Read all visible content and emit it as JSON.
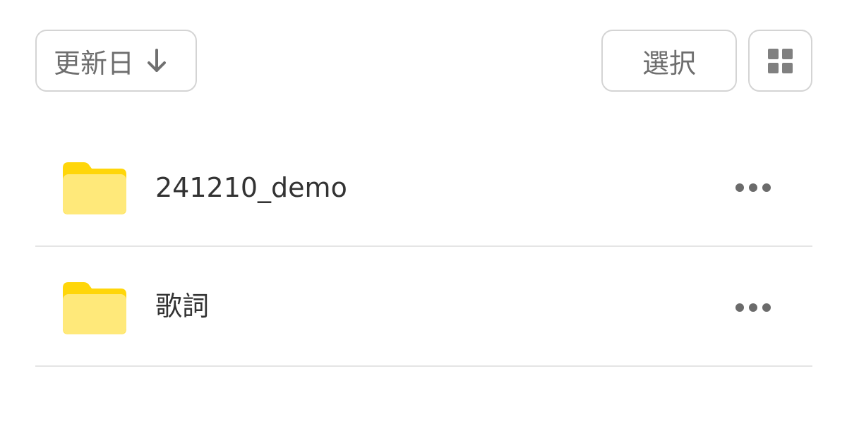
{
  "toolbar": {
    "sort_label": "更新日",
    "sort_direction": "descending",
    "sort_icon": "arrow-down-icon",
    "select_label": "選択",
    "view_icon": "grid-view-icon"
  },
  "folders": [
    {
      "name": "241210_demo",
      "icon": "folder-icon",
      "more_icon": "more-horizontal-icon"
    },
    {
      "name": "歌詞",
      "icon": "folder-icon",
      "more_icon": "more-horizontal-icon"
    }
  ],
  "colors": {
    "folder_tab": "#FFD60A",
    "folder_body": "#FFE97A",
    "text_primary": "#333333",
    "text_secondary": "#6E6E6E",
    "border": "#D4D4D4",
    "divider": "#E5E5E5"
  }
}
